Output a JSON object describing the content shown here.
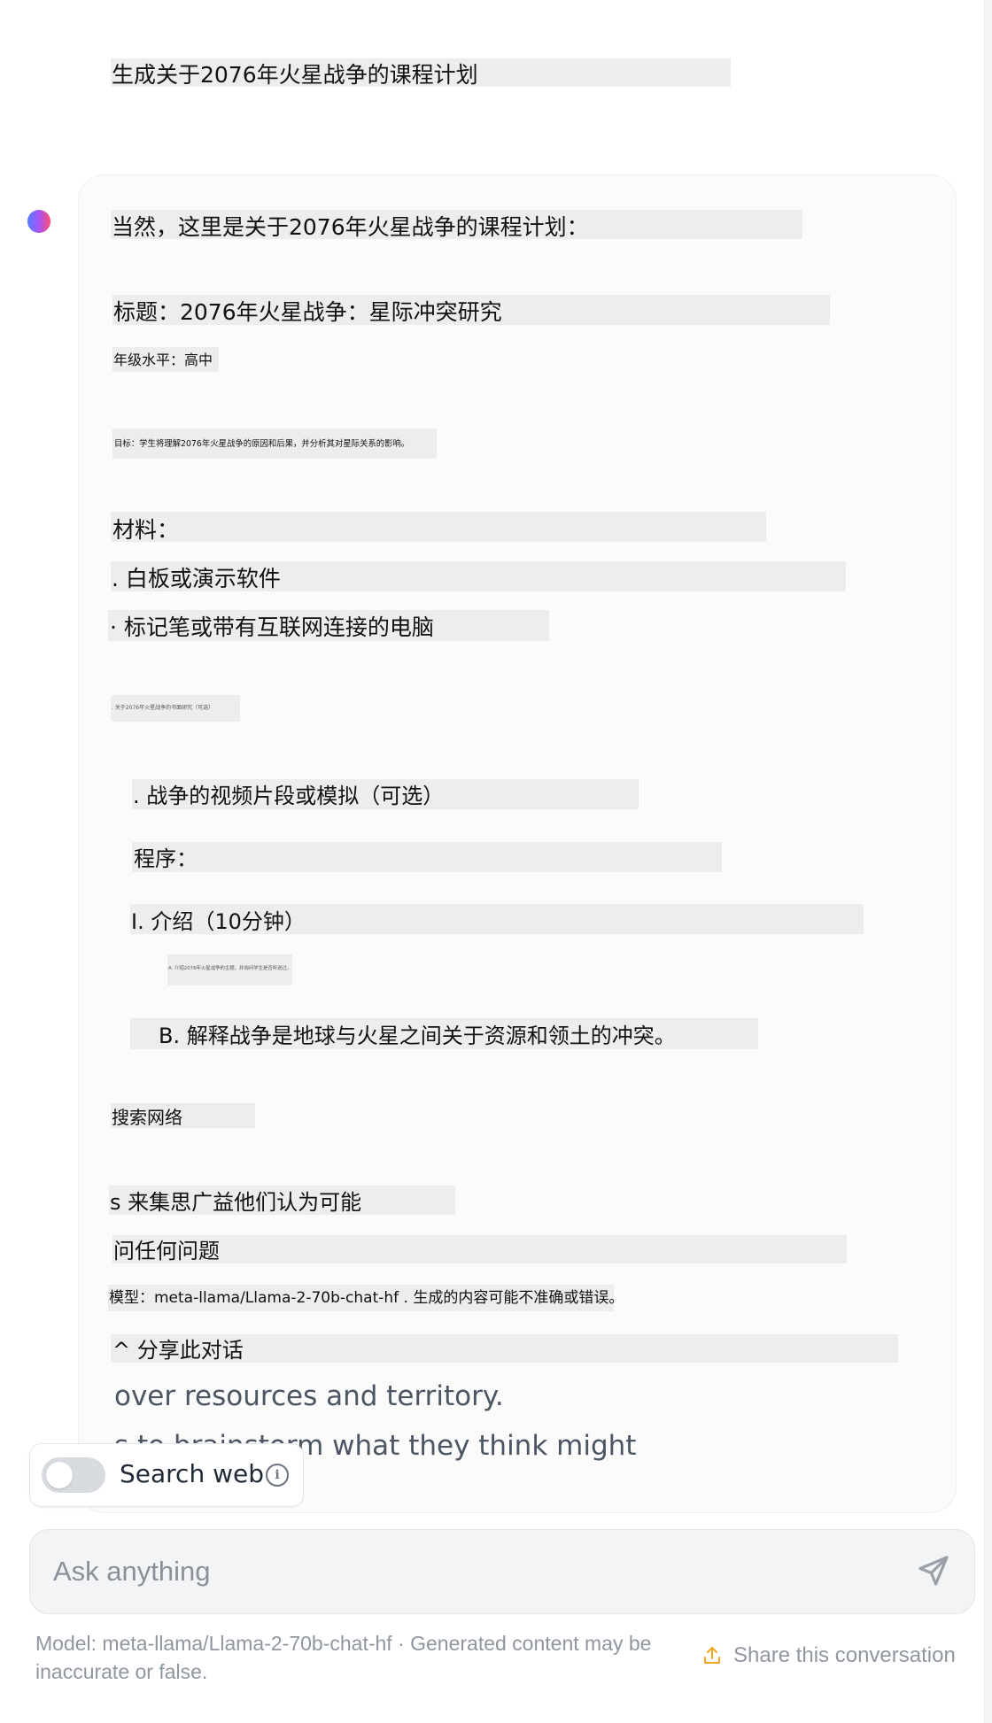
{
  "user_message": "生成关于2076年火星战争的课程计划",
  "assistant_response": {
    "intro": "当然，这里是关于2076年火星战争的课程计划：",
    "title": "标题：2076年火星战争：星际冲突研究",
    "grade": "年级水平：高中",
    "objective": "目标：学生将理解2076年火星战争的原因和后果，并分析其对星际关系的影响。",
    "materials_heading": "材料：",
    "material_1": ". 白板或演示软件",
    "material_2": "· 标记笔或带有互联网连接的电脑",
    "material_3": ". 关于2076年火星战争的书面研究（可选）",
    "material_4": ". 战争的视频片段或模拟（可选）",
    "procedure_heading": "程序：",
    "step_1": "I. 介绍（10分钟）",
    "step_1a": "A. 介绍2076年火星战争的主题，并询问学生是否听说过。",
    "step_1b": "B. 解释战争是地球与火星之间关于资源和领土的冲突。",
    "search_web": "搜索网络",
    "brainstorm": "s 来集思广益他们认为可能",
    "questions": "问任何问题",
    "model_line": "模型：meta-llama/Llama-2-70b-chat-hf . 生成的内容可能不准确或错误。",
    "share_line": "^ 分享此对话",
    "english_line_1": "over resources and territory.",
    "english_line_2": "s to brainstorm what they think might"
  },
  "search_toggle": {
    "label": "Search web",
    "enabled": false,
    "icon": "info-icon"
  },
  "composer": {
    "placeholder": "Ask anything",
    "send_icon": "send-icon"
  },
  "footer": {
    "model_note": "Model: meta-llama/Llama-2-70b-chat-hf · Generated content may be inaccurate or false.",
    "share_label": "Share this conversation",
    "share_icon": "share-icon"
  },
  "colors": {
    "accent": "#f5a524",
    "muted_text": "#9096a0",
    "highlight": "#ededed"
  }
}
